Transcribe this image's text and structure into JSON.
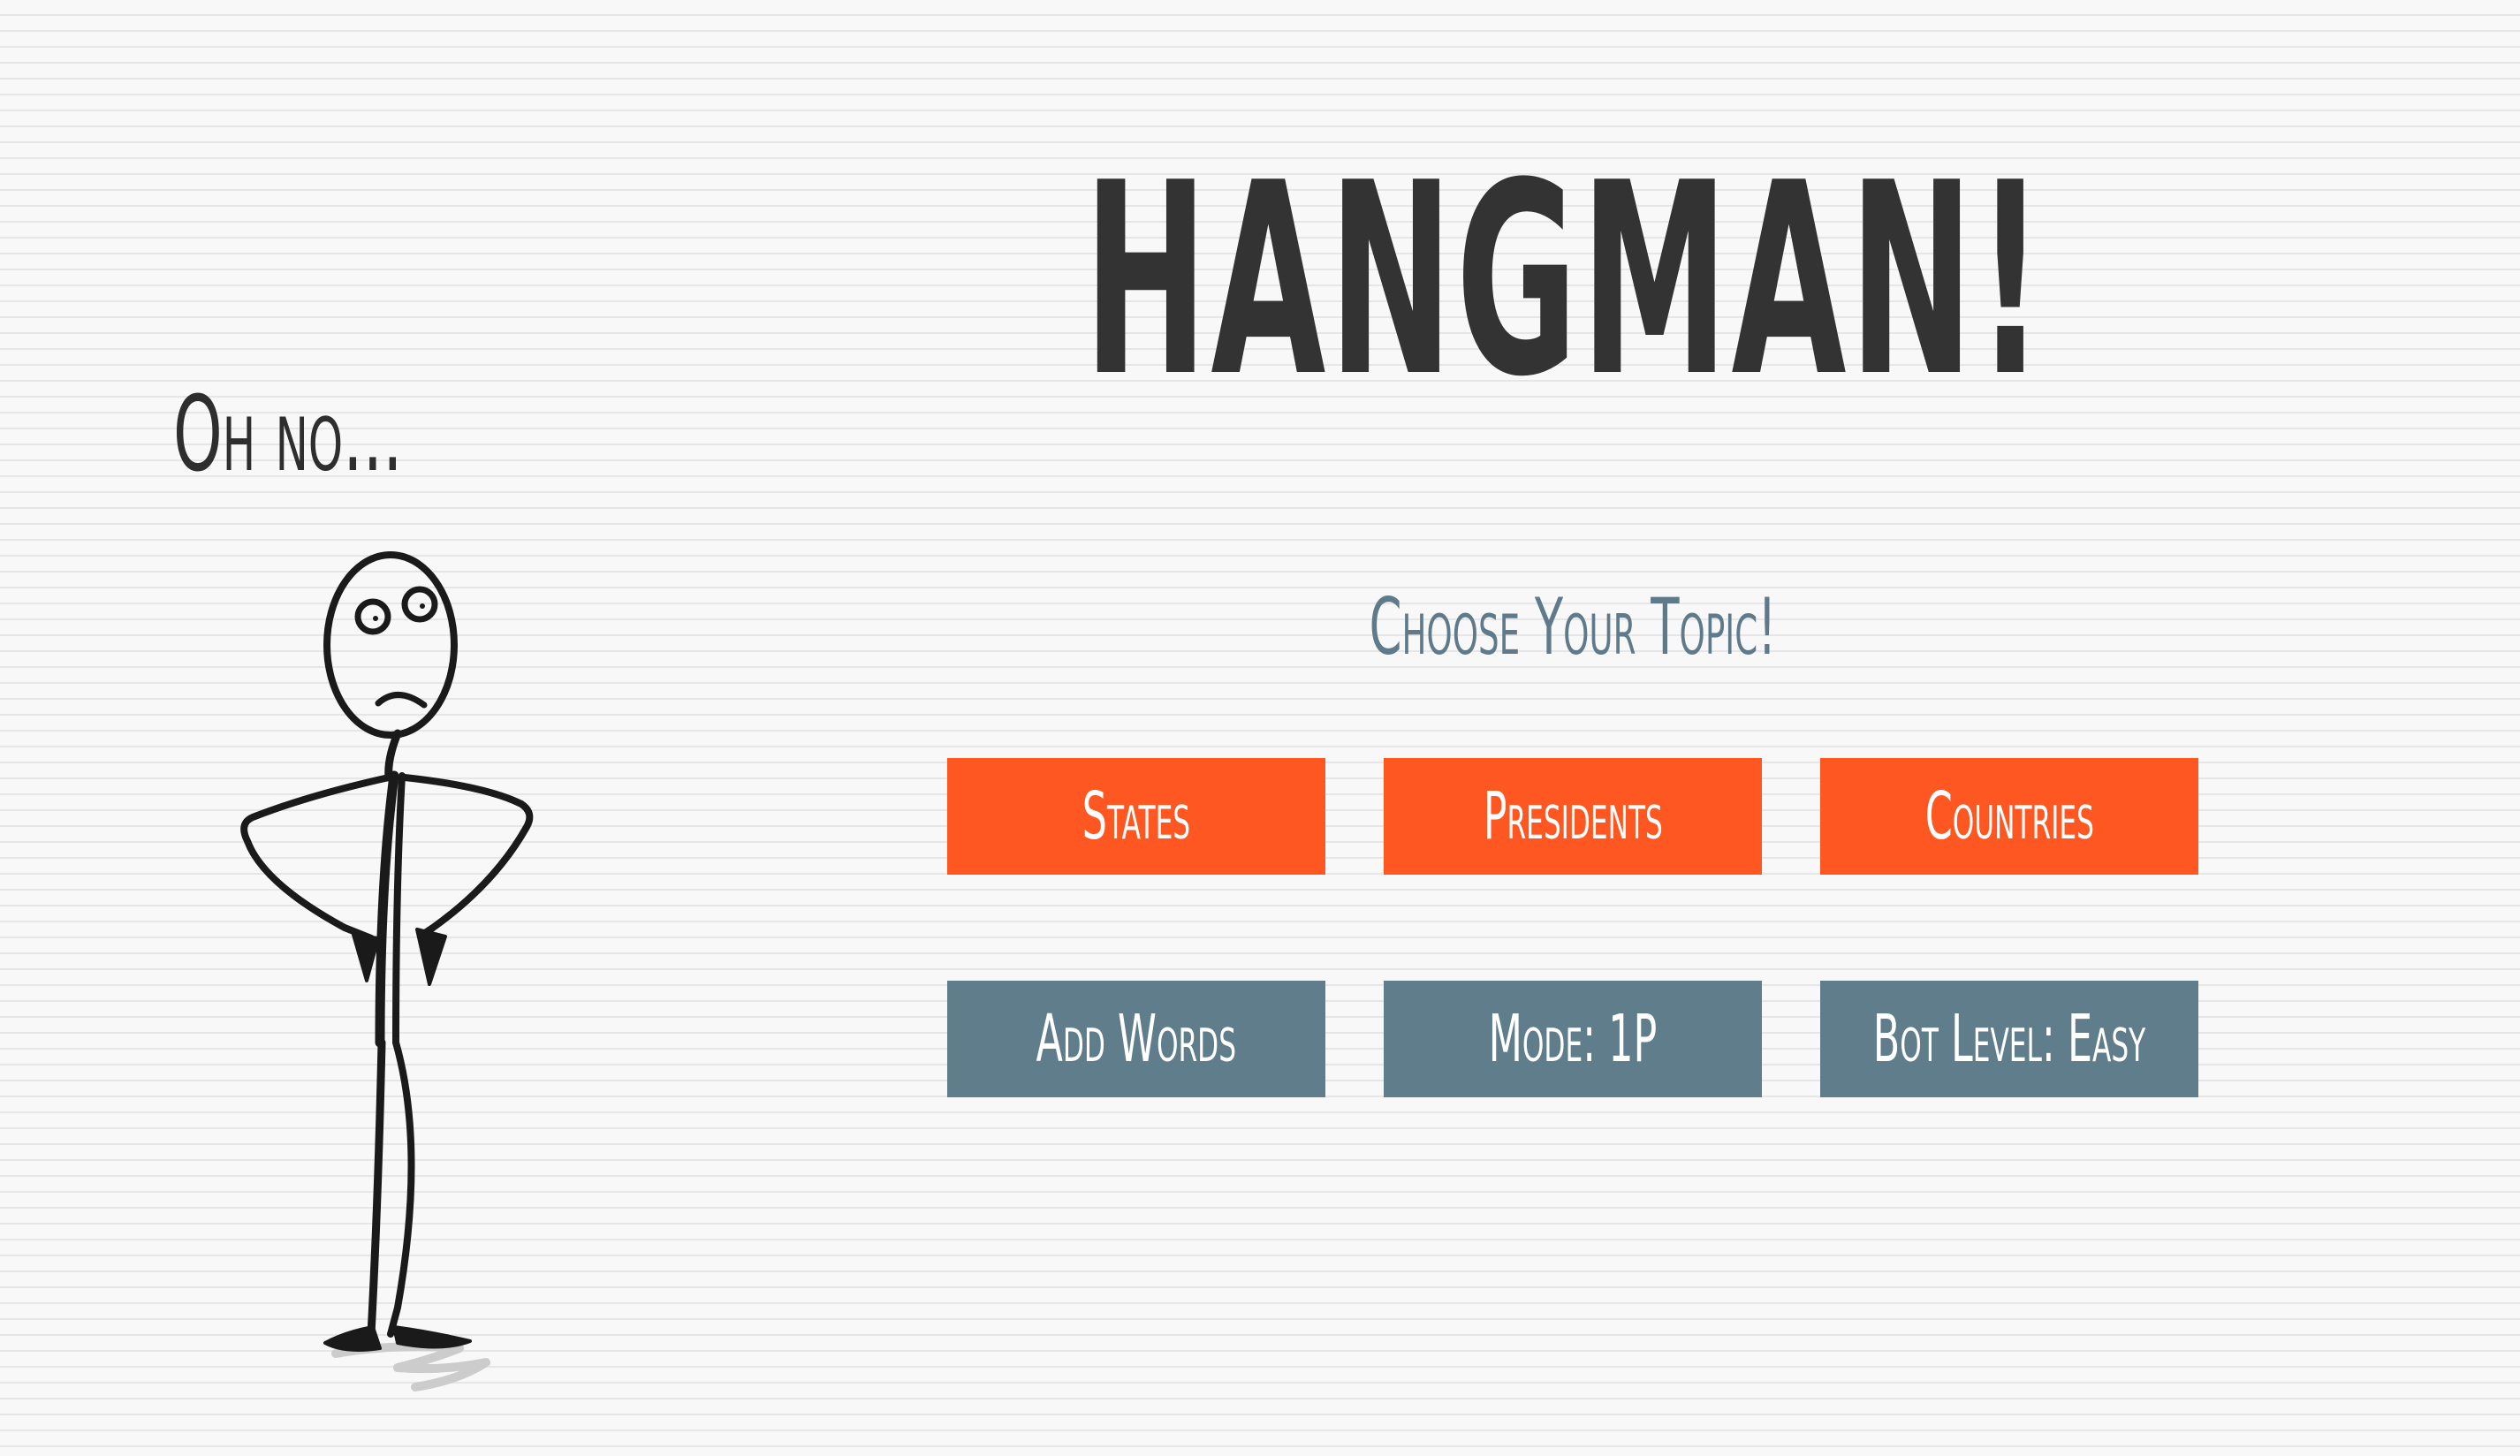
{
  "title": "HANGMAN!",
  "status_text": "Oh no...",
  "subtitle": "Choose Your Topic!",
  "topics": [
    {
      "label": "States"
    },
    {
      "label": "Presidents"
    },
    {
      "label": "Countries"
    }
  ],
  "settings": [
    {
      "label": "Add Words"
    },
    {
      "label": "Mode: 1P"
    },
    {
      "label": "Bot Level: Easy"
    }
  ],
  "colors": {
    "topic_button": "#ff5722",
    "setting_button": "#607d8b",
    "subtitle": "#5f7a8b",
    "title": "#333333"
  },
  "icons": {
    "mascot": "worried-stickman-icon"
  }
}
